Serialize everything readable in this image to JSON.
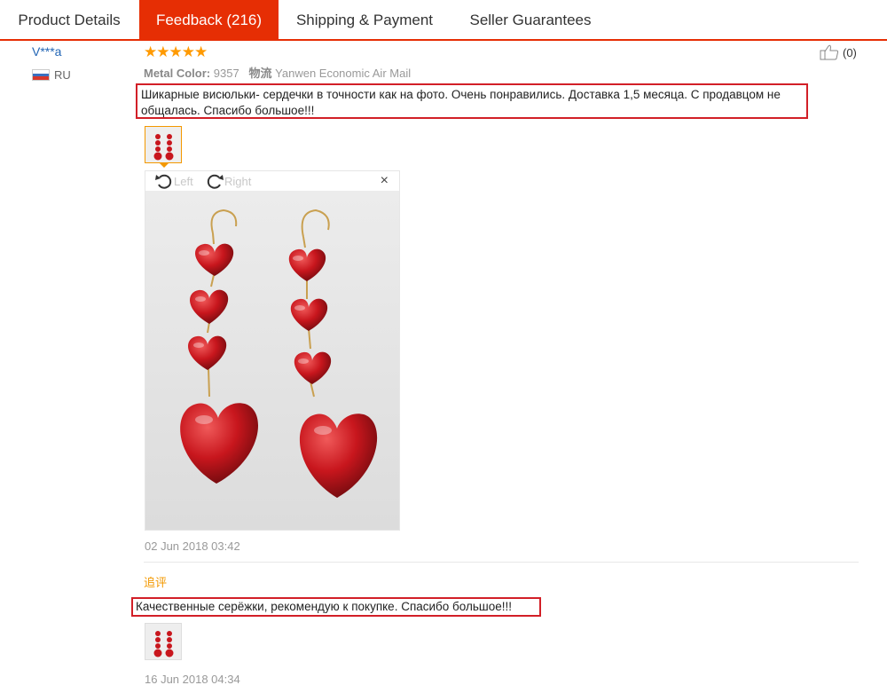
{
  "tabs": {
    "product_details": "Product Details",
    "feedback": "Feedback (216)",
    "shipping": "Shipping & Payment",
    "guarantees": "Seller Guarantees"
  },
  "review": {
    "user": "V***a",
    "country": "RU",
    "stars": "★★★★★",
    "rating": 5,
    "metal_label": "Metal Color:",
    "metal_value": "9357",
    "logistics_label": "物流",
    "logistics_value": "Yanwen Economic Air Mail",
    "helpful_count": "(0)",
    "text": "Шикарные висюльки- сердечки в точности как на фото. Очень понравились. Доставка 1,5 месяца. С продавцом не общалась. Спасибо большое!!!",
    "date": "02 Jun 2018 03:42",
    "viewer": {
      "rotate_left": "Left",
      "rotate_right": "Right",
      "close": "×"
    }
  },
  "additional_feedback": {
    "label": "追评",
    "text": "Качественные серёжки, рекомендую к покупке. Спасибо большое!!!",
    "date": "16 Jun 2018 04:34"
  },
  "colors": {
    "accent": "#e62e04",
    "star": "#ff9a00",
    "username": "#2366b5",
    "highlight_box": "#d21f27",
    "earring_red": "#c8161d"
  }
}
